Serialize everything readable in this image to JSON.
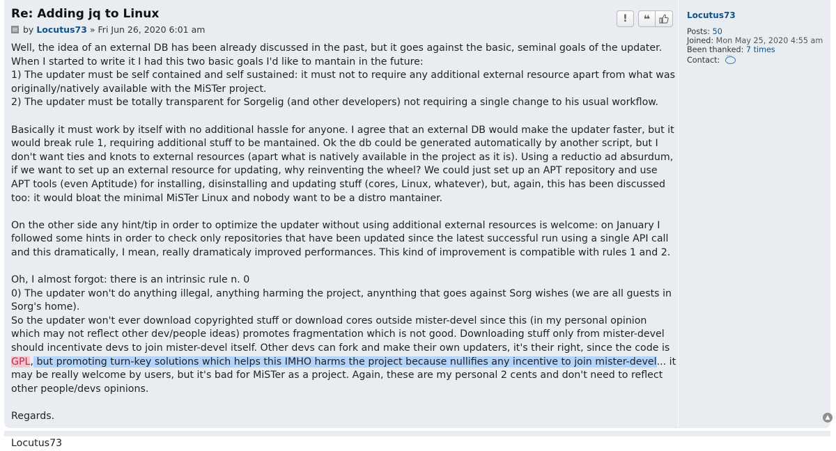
{
  "post": {
    "title": "Re: Adding jq to Linux",
    "author_prefix": "by",
    "author": "Locutus73",
    "date_sep": "»",
    "date": "Fri Jun 26, 2020 6:01 am",
    "buttons": {
      "report": "!",
      "quote": "❝",
      "like": "👍"
    },
    "body": {
      "p1": "Well, the idea of an external DB has been already discussed in the past, but it goes against the basic, seminal goals of the updater. When I started to write it I had this two basic goals I'd like to mantain in the future:",
      "p1_rule1": "1) The updater must be self contained and self sustained: it must not to require any additional external resource apart from what was originally/natively available with the MiSTer project.",
      "p1_rule2": "2) The updater must be totally transparent for Sorgelig (and other developers) not requiring a single change to his usual workflow.",
      "p2": "Basically it must work by itself with no additional hassle for anyone. I agree that an external DB would make the updater faster, but it would break rule 1, requiring additional stuff to be mantained. Ok the db could be generated automatically by another script, but I don't want ties and knots to external resources (apart what is natively available in the project as it is). Using a reductio ad absurdum, if we want to set up an external resource for updating, why reinventing the wheel? We could just set up an APT repository and use APT tools (even Aptitude) for installing, disinstalling and updating stuff (cores, Linux, whatever), but, again, this has been discussed too: it would bloat the minimal MiSTer Linux and nobody want to be a distro mantainer.",
      "p3": "On the other side any hint/tip in order to optimize the updater without using additional external resources is welcome: on January I followed some hints in order to check only repositories that have been updated since the latest successful run using a single API call and this dramatically, I mean, really dramaticaly improved performances. This kind of improvement is compatible with rules 1 and 2.",
      "p4_intro": "Oh, I almost forgot: there is an intrinsic rule n. 0",
      "p4_rule0": "0) The updater won't do anything illegal, anything harming the project, anynthing that goes against Sorg wishes (we are all guests in Sorg's home).",
      "p4_main_a": "So the updater won't ever download copyrighted stuff or download cores outside mister-devel since this (in my personal opinion which may not reflect other dev/people ideas) promotes fragmentation which is not good. Downloading stuff only from mister-devel should incentivate devs to join mister-devel itself. Other devs can fork and make their own updaters, it's their right, since the code is ",
      "gpl": "GPL",
      "p4_comma": ",",
      "p4_highlight": " but promoting turn-key solutions which helps this IMHO harms the project because nullifies any incentive to join mister-devel",
      "p4_main_b": "... it may be really welcome by users, but it's bad for MiSTer as a project. Again, these are my personal 2 cents and don't need to reflect other people/devs opinions.",
      "regards": "Regards.",
      "signature": "Locutus73"
    }
  },
  "profile": {
    "username": "Locutus73",
    "posts_label": "Posts:",
    "posts_value": "50",
    "joined_label": "Joined:",
    "joined_value": "Mon May 25, 2020 4:55 am",
    "thanked_label": "Been thanked:",
    "thanked_value": "7 times",
    "contact_label": "Contact:"
  },
  "back_to_top": "▲",
  "colors": {
    "post_bg": "#e9edf1",
    "link": "#105289",
    "gpl_bg": "#f7c7d0",
    "selection": "#b3d4fc"
  }
}
